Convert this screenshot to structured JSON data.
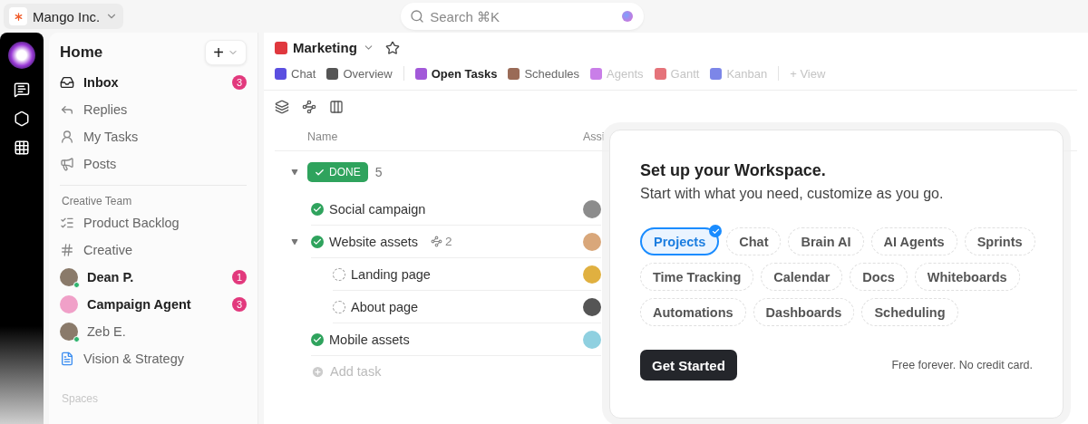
{
  "workspace": {
    "name": "Mango Inc."
  },
  "search": {
    "placeholder": "Search ⌘K"
  },
  "sidebar": {
    "title": "Home",
    "add_label": "+",
    "items": [
      {
        "kind": "inbox",
        "label": "Inbox",
        "unread": true,
        "badge": "3"
      },
      {
        "kind": "reply",
        "label": "Replies",
        "unread": false
      },
      {
        "kind": "tasks",
        "label": "My Tasks",
        "unread": false
      },
      {
        "kind": "posts",
        "label": "Posts",
        "unread": false
      }
    ],
    "section": "Creative Team",
    "team_items": [
      {
        "kind": "list",
        "label": "Product Backlog",
        "unread": false
      },
      {
        "kind": "channel",
        "label": "Creative",
        "unread": false
      },
      {
        "kind": "person",
        "label": "Dean P.",
        "unread": true,
        "badge": "1",
        "online": true
      },
      {
        "kind": "agent",
        "label": "Campaign Agent",
        "unread": true,
        "badge": "3",
        "online": false
      },
      {
        "kind": "person",
        "label": "Zeb E.",
        "unread": false,
        "online": true
      },
      {
        "kind": "doc",
        "label": "Vision & Strategy",
        "unread": false
      }
    ],
    "spaces_heading": "Spaces"
  },
  "space": {
    "name": "Marketing",
    "views": [
      {
        "label": "Chat",
        "color": "#5b4fe0",
        "faded": false,
        "selected": false
      },
      {
        "label": "Overview",
        "color": "#555555",
        "faded": false,
        "selected": false
      },
      {
        "label": "Open Tasks",
        "color": "#a259d9",
        "faded": false,
        "selected": true
      },
      {
        "label": "Schedules",
        "color": "#9a6b57",
        "faded": false,
        "selected": false
      },
      {
        "label": "Agents",
        "color": "#c97ee8",
        "faded": true,
        "selected": false
      },
      {
        "label": "Gantt",
        "color": "#e5737a",
        "faded": true,
        "selected": false
      },
      {
        "label": "Kanban",
        "color": "#7c86e8",
        "faded": true,
        "selected": false
      }
    ],
    "add_view": "+ View"
  },
  "table": {
    "columns": [
      "Name",
      "Assi"
    ],
    "group": {
      "status": "DONE",
      "count": "5",
      "expanded": true
    },
    "rows": [
      {
        "name": "Social campaign",
        "done": true,
        "color": "#8c8c8c"
      },
      {
        "name": "Website assets",
        "done": true,
        "subtasks": "2",
        "expanded": true,
        "color": "#d9a77a",
        "children": [
          {
            "name": "Landing page",
            "done": false,
            "color": "#e0b040"
          },
          {
            "name": "About page",
            "done": false,
            "color": "#555555"
          }
        ]
      },
      {
        "name": "Mobile assets",
        "done": true,
        "color": "#8fd0e0"
      }
    ],
    "add_task": "Add task"
  },
  "setup_card": {
    "title": "Set up your Workspace.",
    "subtitle": "Start with what you need, customize as you go.",
    "options": [
      {
        "label": "Projects",
        "selected": true
      },
      {
        "label": "Chat",
        "selected": false
      },
      {
        "label": "Brain AI",
        "selected": false
      },
      {
        "label": "AI Agents",
        "selected": false
      },
      {
        "label": "Sprints",
        "selected": false
      },
      {
        "label": "Time Tracking",
        "selected": false
      },
      {
        "label": "Calendar",
        "selected": false
      },
      {
        "label": "Docs",
        "selected": false
      },
      {
        "label": "Whiteboards",
        "selected": false
      },
      {
        "label": "Automations",
        "selected": false
      },
      {
        "label": "Dashboards",
        "selected": false
      },
      {
        "label": "Scheduling",
        "selected": false
      }
    ],
    "button": "Get Started",
    "note": "Free forever. No credit card."
  }
}
